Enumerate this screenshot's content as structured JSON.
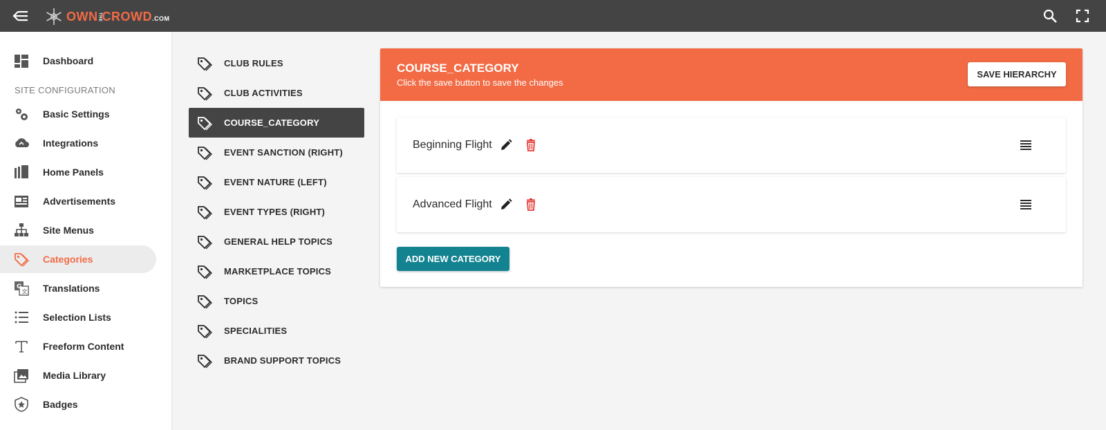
{
  "brand": {
    "own": "OWN",
    "the": "THE",
    "crowd": "CROWD",
    "com": ".COM",
    "accent_color": "#f26b45",
    "topbar_color": "#444444"
  },
  "topbar": {
    "back_icon": "arrow-back-menu-icon",
    "search_icon": "search-icon",
    "fullscreen_icon": "fullscreen-icon"
  },
  "sidebar": {
    "dashboard": "Dashboard",
    "section_header": "SITE CONFIGURATION",
    "items": [
      {
        "label": "Basic Settings",
        "icon": "gears-icon"
      },
      {
        "label": "Integrations",
        "icon": "cloud-sync-icon"
      },
      {
        "label": "Home Panels",
        "icon": "panels-icon"
      },
      {
        "label": "Advertisements",
        "icon": "advertisement-icon"
      },
      {
        "label": "Site Menus",
        "icon": "sitemap-icon"
      },
      {
        "label": "Categories",
        "icon": "tags-icon",
        "active": true
      },
      {
        "label": "Translations",
        "icon": "translate-icon"
      },
      {
        "label": "Selection Lists",
        "icon": "list-icon"
      },
      {
        "label": "Freeform Content",
        "icon": "text-icon"
      },
      {
        "label": "Media Library",
        "icon": "media-library-icon"
      },
      {
        "label": "Badges",
        "icon": "badge-icon"
      }
    ]
  },
  "categories": {
    "items": [
      {
        "label": "CLUB RULES"
      },
      {
        "label": "CLUB ACTIVITIES"
      },
      {
        "label": "COURSE_CATEGORY",
        "active": true
      },
      {
        "label": "EVENT SANCTION (RIGHT)"
      },
      {
        "label": "EVENT NATURE (LEFT)"
      },
      {
        "label": "EVENT TYPES (RIGHT)"
      },
      {
        "label": "GENERAL HELP TOPICS"
      },
      {
        "label": "MARKETPLACE TOPICS"
      },
      {
        "label": "TOPICS"
      },
      {
        "label": "SPECIALITIES"
      },
      {
        "label": "BRAND SUPPORT TOPICS"
      }
    ]
  },
  "panel": {
    "title": "COURSE_CATEGORY",
    "subtitle": "Click the save button to save the changes",
    "save_label": "SAVE HIERARCHY",
    "add_label": "ADD NEW CATEGORY",
    "add_color": "#138391",
    "delete_color": "#e53935",
    "rows": [
      {
        "name": "Beginning Flight"
      },
      {
        "name": "Advanced Flight"
      }
    ]
  }
}
